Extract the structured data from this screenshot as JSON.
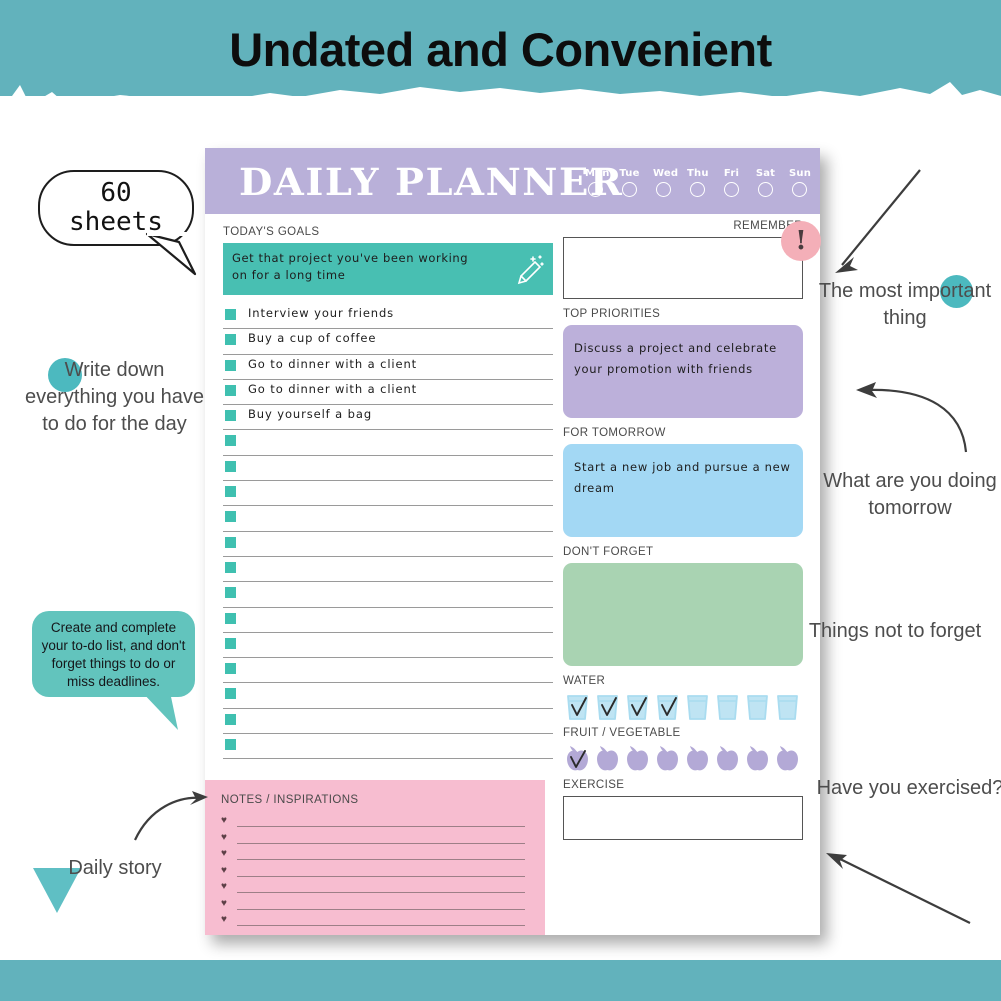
{
  "banner": {
    "title": "Undated and Convenient",
    "teal": "#62b2bc"
  },
  "planner": {
    "logo": "DAILY PLANNER",
    "header_color": "#b9b0d9",
    "days": [
      "Mon",
      "Tue",
      "Wed",
      "Thu",
      "Fri",
      "Sat",
      "Sun"
    ],
    "goals": {
      "label": "TODAY'S GOALS",
      "text": "Get that project you've been working on for a long time",
      "color": "#48bfb2",
      "icon": "pencil-icon"
    },
    "todos": [
      "Interview your friends",
      "Buy a cup of coffee",
      "Go to dinner with a client",
      "Go to dinner with a client",
      "Buy yourself a bag"
    ],
    "todo_empty_rows": 13,
    "todo_checkbox_color": "#3fc0b0",
    "notes": {
      "label": "NOTES / INSPIRATIONS",
      "color": "#f7bdd0",
      "line_count": 7,
      "bullet": "heart-icon"
    },
    "remember": {
      "label": "REMEMBER",
      "badge": "!",
      "badge_color": "#f4afb8",
      "value": ""
    },
    "priorities": {
      "label": "TOP PRIORITIES",
      "text": "Discuss a project and celebrate your promotion with friends",
      "color": "#bcb0da"
    },
    "tomorrow": {
      "label": "FOR TOMORROW",
      "text": "Start a new job and pursue a new dream",
      "color": "#a3d8f4"
    },
    "forget": {
      "label": "DON'T FORGET",
      "text": "",
      "color": "#a9d3b2"
    },
    "water": {
      "label": "WATER",
      "total": 8,
      "checked": 4,
      "icon": "glass-icon",
      "color": "#a9dcf0"
    },
    "fruit": {
      "label": "FRUIT / VEGETABLE",
      "total": 8,
      "checked": 1,
      "icon": "apple-icon",
      "color": "#b3a9d6"
    },
    "exercise": {
      "label": "EXERCISE",
      "value": ""
    }
  },
  "annotations": {
    "sheets_bubble": {
      "line1": "60",
      "line2": "sheets"
    },
    "write_down": "Write down everything you have to do for the day",
    "todo_bubble": "Create and complete your to-do list, and don't forget things to do or miss deadlines.",
    "daily_story": "Daily story",
    "most_important": "The most important thing",
    "what_tomorrow": "What are you doing tomorrow",
    "things_not_forget": "Things not to forget",
    "exercised": "Have you exercised?",
    "accent_teal": "#4cb9bf"
  }
}
